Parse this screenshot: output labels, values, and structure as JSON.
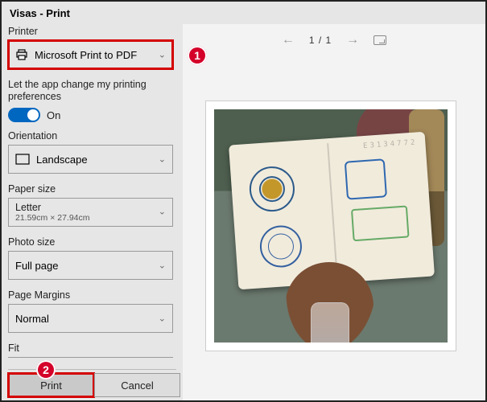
{
  "window": {
    "title": "Visas - Print"
  },
  "sidebar": {
    "printer_label": "Printer",
    "printer_value": "Microsoft Print to PDF",
    "pref_text": "Let the app change my printing preferences",
    "toggle_state": "On",
    "orientation_label": "Orientation",
    "orientation_value": "Landscape",
    "paper_label": "Paper size",
    "paper_value": "Letter",
    "paper_sub": "21.59cm × 27.94cm",
    "photosize_label": "Photo size",
    "photosize_value": "Full page",
    "margins_label": "Page Margins",
    "margins_value": "Normal",
    "fit_label": "Fit"
  },
  "footer": {
    "print": "Print",
    "cancel": "Cancel"
  },
  "preview": {
    "page_indicator": "1 / 1",
    "passport_num": "E3134772"
  },
  "callouts": {
    "c1": "1",
    "c2": "2"
  }
}
